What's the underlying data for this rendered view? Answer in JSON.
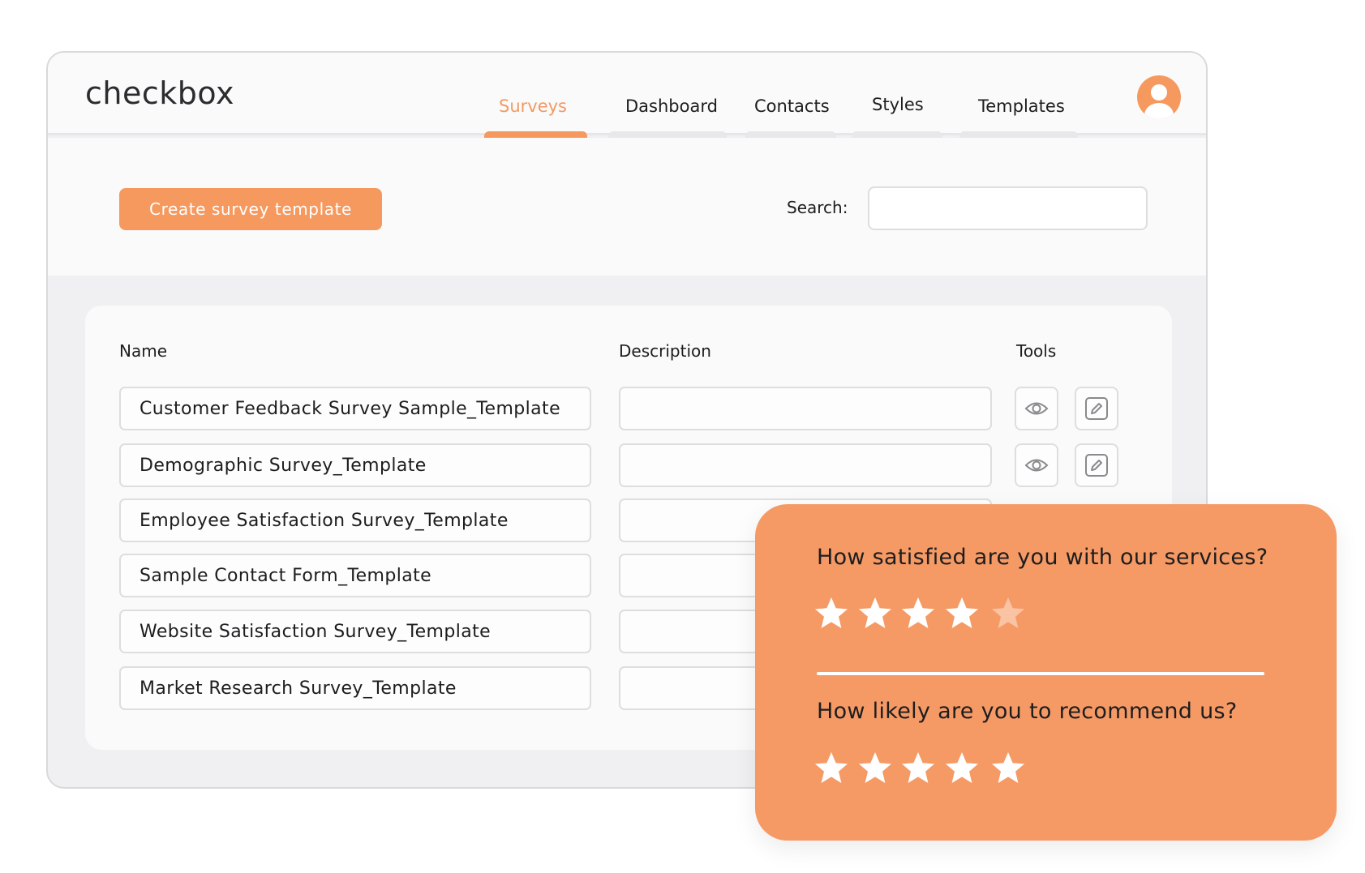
{
  "app": {
    "logo": "checkbox"
  },
  "nav": {
    "tabs": [
      {
        "label": "Surveys",
        "active": true
      },
      {
        "label": "Dashboard",
        "active": false
      },
      {
        "label": "Contacts",
        "active": false
      },
      {
        "label": "Styles",
        "active": false
      },
      {
        "label": "Templates",
        "active": false
      }
    ]
  },
  "toolbar": {
    "create_label": "Create survey template",
    "search_label": "Search:",
    "search_value": ""
  },
  "table": {
    "headers": {
      "name": "Name",
      "description": "Description",
      "tools": "Tools"
    },
    "rows": [
      {
        "name": "Customer Feedback Survey Sample_Template",
        "description": ""
      },
      {
        "name": "Demographic Survey_Template",
        "description": ""
      },
      {
        "name": "Employee Satisfaction Survey_Template",
        "description": ""
      },
      {
        "name": "Sample Contact Form_Template",
        "description": ""
      },
      {
        "name": "Website Satisfaction Survey_Template",
        "description": ""
      },
      {
        "name": "Market Research Survey_Template",
        "description": ""
      }
    ],
    "tool_icons": [
      "eye-icon",
      "edit-icon"
    ]
  },
  "rating_card": {
    "questions": [
      {
        "text": "How satisfied are you with our services?",
        "rating": 4,
        "max": 5
      },
      {
        "text": "How likely are you to recommend us?",
        "rating": 5,
        "max": 5
      }
    ]
  },
  "colors": {
    "accent": "#f6995f",
    "accent_text": "#f19a64",
    "card": "#f69a65",
    "star_empty": "#f9c3a4"
  }
}
